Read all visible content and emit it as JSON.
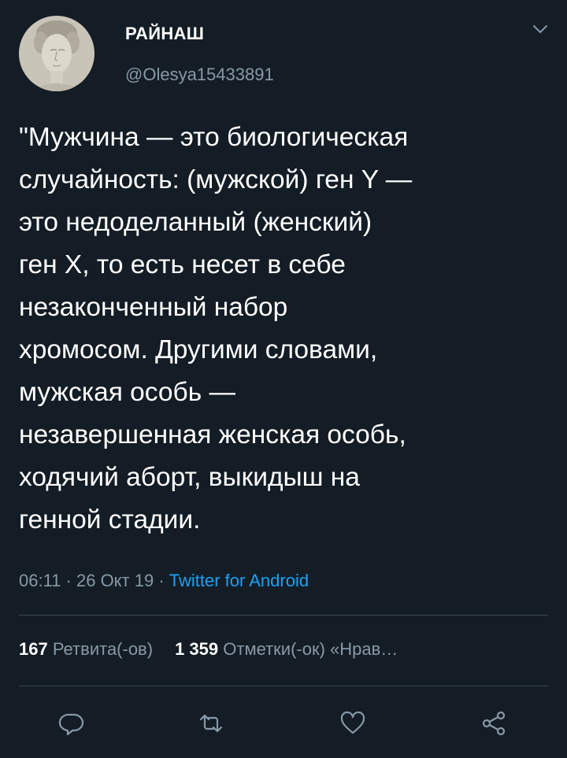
{
  "user": {
    "display_name": "РАЙНАШ",
    "handle": "@Olesya15433891"
  },
  "tweet": {
    "text": "\"Мужчина — это биологическая\nслучайность: (мужской) ген Y —\nэто недоделанный (женский)\nген X, то есть несет в себе\nнезаконченный набор\nхромосом. Другими словами,\nмужская особь —\nнезавершенная женская особь,\nходячий аборт, выкидыш на\nгенной стадии."
  },
  "meta": {
    "time": "06:11",
    "separator": " · ",
    "date": "26 Окт 19",
    "source": "Twitter for Android"
  },
  "stats": {
    "retweets_count": "167",
    "retweets_label": "Ретвита(-ов)",
    "likes_count": "1 359",
    "likes_label": "Отметки(-ок) «Нрав…"
  },
  "actions": {
    "reply": "reply-icon",
    "retweet": "retweet-icon",
    "like": "heart-icon",
    "share": "share-icon"
  },
  "colors": {
    "background": "#141d26",
    "secondary_text": "#8899a6",
    "link": "#1da1f2",
    "divider": "#38444d"
  }
}
